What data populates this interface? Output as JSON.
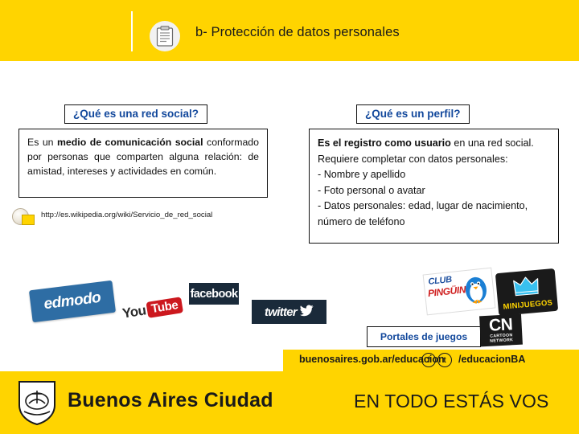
{
  "header": {
    "title": "b- Protección de datos personales",
    "icon": "clipboard-icon",
    "background_color": "#ffd400"
  },
  "content": {
    "question_red": "¿Qué es una red social?",
    "answer_red_html": "Es un <b>medio de comunicación social</b> conformado por personas que comparten alguna relación: de amistad, intereses y actividades en común.",
    "question_perfil": "¿Qué es un perfil?",
    "answer_perfil_lead": "Es el registro como usuario",
    "answer_perfil_rest": " en una red social.",
    "answer_perfil_line2": "Requiere completar con datos personales:",
    "answer_perfil_bullets": [
      "- Nombre y apellido",
      "- Foto personal o avatar",
      "- Datos personales: edad, lugar de nacimiento, número de teléfono"
    ],
    "source_url": "http://es.wikipedia.org/wiki/Servicio_de_red_social",
    "title_color": "#12489c"
  },
  "logos": {
    "edmodo": "edmodo",
    "youtube_you": "You",
    "youtube_tube": "Tube",
    "facebook": "facebook",
    "twitter": "twitter",
    "clubpenguin_line1": "CLUB",
    "clubpenguin_line2": "PINGÜINO",
    "minijuegos": "MINIJUEGOS",
    "portales_label": "Portales de juegos",
    "cartoon_big": "CN",
    "cartoon_small": "CARTOON NETWORK"
  },
  "url_band": {
    "url": "buenosaires.gob.ar/educacion",
    "icon_facebook": "f",
    "icon_twitter": "t",
    "handle": "/educacionBA"
  },
  "footer": {
    "brand": "Buenos Aires Ciudad",
    "slogan": "EN TODO ESTÁS VOS",
    "shield": "buenos-aires-shield-icon"
  }
}
